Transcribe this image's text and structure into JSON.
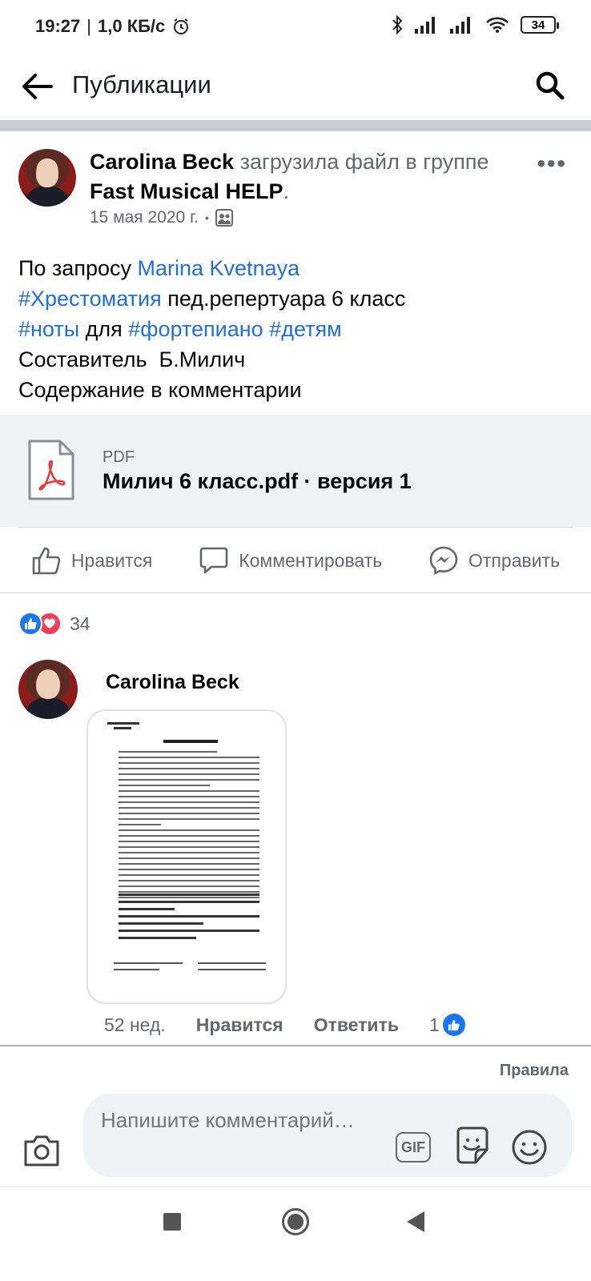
{
  "status_bar": {
    "time": "19:27",
    "speed": "1,0 КБ/с",
    "battery": "34",
    "icons": [
      "alarm-icon",
      "bluetooth-icon",
      "signal-icon",
      "signal-icon",
      "wifi-icon",
      "battery-icon"
    ]
  },
  "header": {
    "title": "Публикации",
    "back_icon": "arrow-left-icon",
    "search_icon": "search-icon"
  },
  "post": {
    "author": "Carolina Beck",
    "action_text": "загрузила файл в группе",
    "group": "Fast Musical HELP",
    "period": ".",
    "date": "15 мая 2020 г.",
    "dot": "•",
    "audience_icon": "group-icon",
    "more_icon": "more-icon",
    "text": {
      "line1_prefix": "По запросу ",
      "line1_mention": "Marina Kvetnaya",
      "line2_tag": "#Хрестоматия",
      "line2_rest": " пед.репертуара 6 класс",
      "line3_tag1": "#ноты",
      "line3_mid": " для ",
      "line3_tag2": "#фортепиано",
      "line3_space": " ",
      "line3_tag3": "#детям",
      "line4": "Составитель  Б.Милич",
      "line5": "Содержание в комментарии"
    },
    "attachment": {
      "type": "PDF",
      "name": "Милич 6 класс.pdf · версия 1",
      "icon": "pdf-icon"
    },
    "actions": [
      {
        "label": "Нравится",
        "icon": "like-icon"
      },
      {
        "label": "Комментировать",
        "icon": "comment-icon"
      },
      {
        "label": "Отправить",
        "icon": "messenger-icon"
      }
    ],
    "reactions": {
      "count": "34",
      "types": [
        "like",
        "love"
      ]
    }
  },
  "comment": {
    "author": "Carolina Beck",
    "time": "52 нед.",
    "like_label": "Нравится",
    "reply_label": "Ответить",
    "like_count": "1"
  },
  "composer": {
    "rules_label": "Правила",
    "placeholder": "Напишите комментарий…",
    "gif_label": "GIF",
    "icons": [
      "camera-icon",
      "gif-icon",
      "sticker-icon",
      "emoji-icon"
    ]
  },
  "colors": {
    "link": "#216fdb",
    "like_blue": "#1877f2",
    "love_red": "#f33e58",
    "secondary_text": "#65676b"
  }
}
